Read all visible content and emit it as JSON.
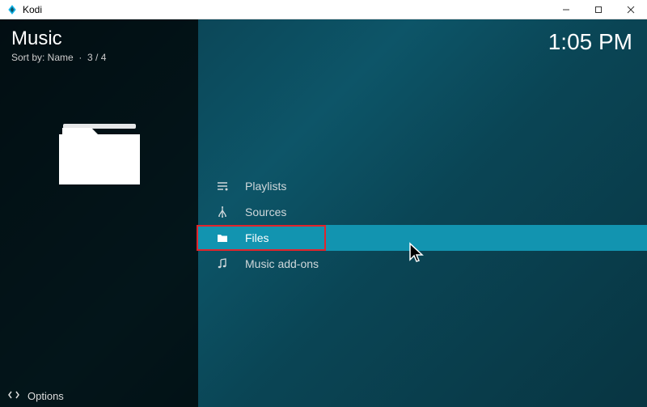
{
  "window": {
    "title": "Kodi"
  },
  "sidebar": {
    "section_title": "Music",
    "sort_label": "Sort by: Name",
    "position": "3 / 4",
    "options_label": "Options"
  },
  "header": {
    "clock": "1:05 PM"
  },
  "menu": {
    "items": [
      {
        "icon": "playlist-icon",
        "label": "Playlists"
      },
      {
        "icon": "sources-icon",
        "label": "Sources"
      },
      {
        "icon": "folder-icon",
        "label": "Files"
      },
      {
        "icon": "music-note-icon",
        "label": "Music add-ons"
      }
    ]
  }
}
